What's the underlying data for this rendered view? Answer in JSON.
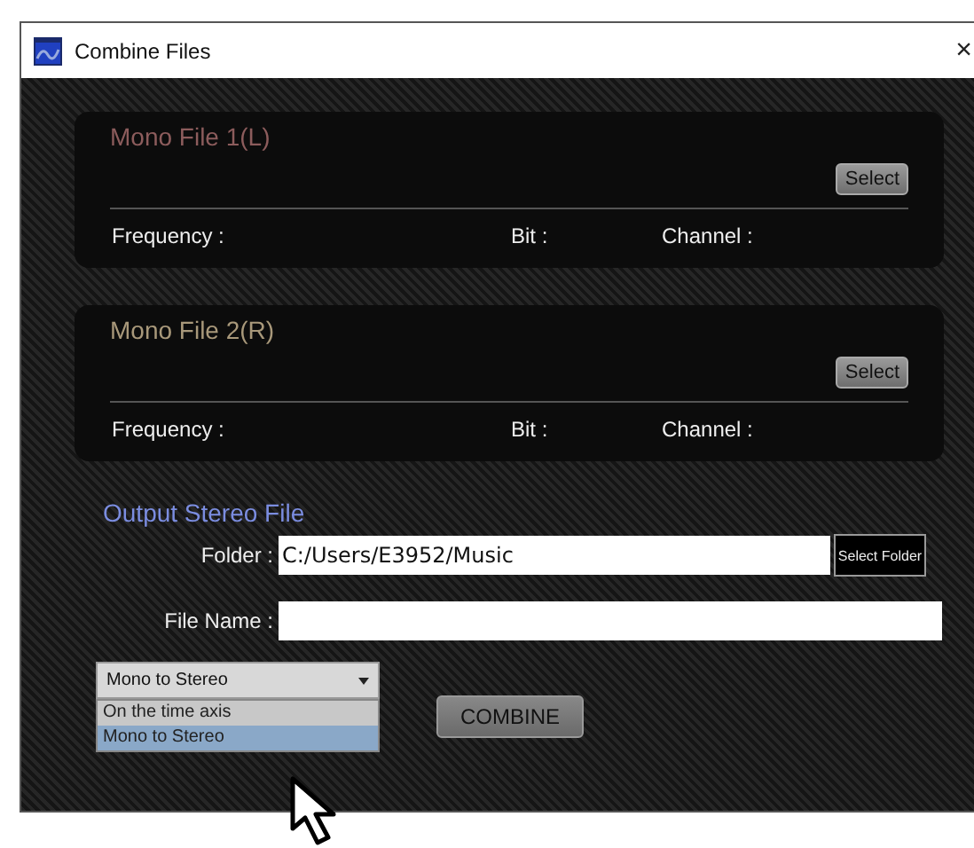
{
  "window": {
    "title": "Combine Files",
    "close": "×"
  },
  "panels": [
    {
      "title": "Mono File 1(L)",
      "color": "#8c5c5c",
      "button": "Select",
      "fields": [
        "Frequency :",
        "Bit :",
        "Channel :"
      ]
    },
    {
      "title": "Mono File 2(R)",
      "color": "#a8987a",
      "button": "Select",
      "fields": [
        "Frequency :",
        "Bit :",
        "Channel :"
      ]
    }
  ],
  "output": {
    "title": "Output Stereo File",
    "folder_label": "Folder :",
    "folder_value": "C:/Users/E3952/Music",
    "folder_button": "Select Folder",
    "filename_label": "File Name :"
  },
  "mode_dropdown": {
    "value": "Mono to Stereo",
    "expanded": true,
    "options": [
      {
        "label": "On the time axis",
        "selected": false
      },
      {
        "label": "Mono to Stereo",
        "selected": true
      }
    ]
  },
  "combine_button": "COMBINE"
}
